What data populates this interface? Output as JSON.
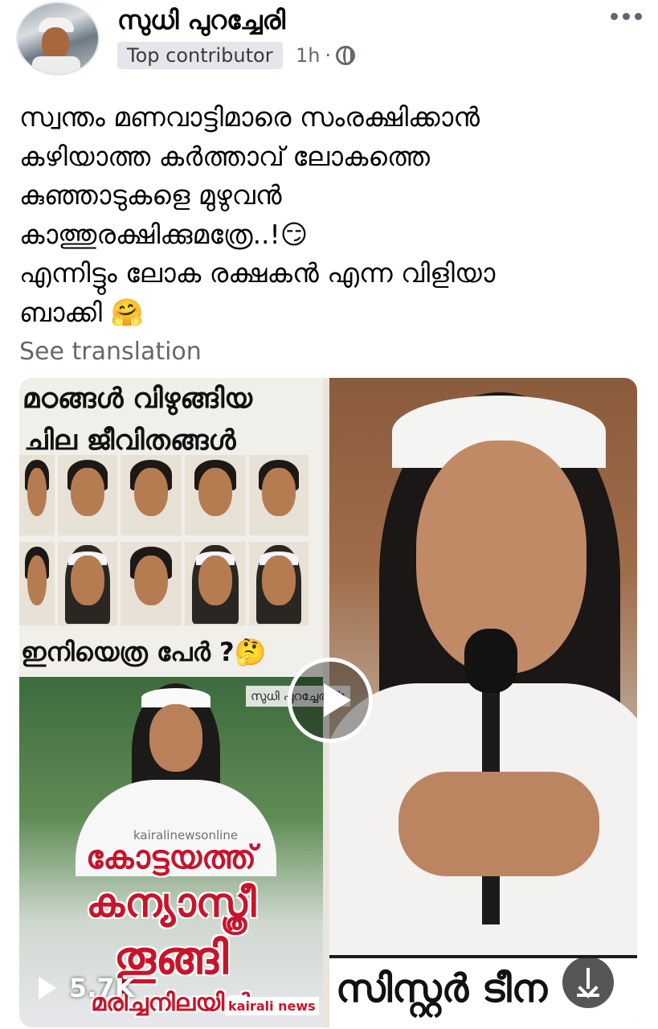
{
  "post": {
    "author_name": "സുധി പുറച്ചേരി",
    "badge": "Top contributor",
    "time": "1h",
    "separator": "·",
    "privacy_icon": "globe-icon",
    "more_icon": "more-horizontal-icon",
    "text_lines": [
      "സ്വന്തം മണവാട്ടിമാരെ സംരക്ഷിക്കാൻ",
      "കഴിയാത്ത  കർത്താവ് ലോകത്തെ",
      "കുഞ്ഞാടുകളെ മുഴുവൻ",
      "കാത്തുരക്ഷിക്കുമത്രേ..!😏",
      "എന്നിട്ടും ലോക രക്ഷകൻ എന്ന വിളിയാ",
      "ബാക്കി 🤗"
    ],
    "see_translation": "See translation"
  },
  "media": {
    "left_panel": {
      "title_line1": "മഠങ്ങൾ വിഴുങ്ങിയ",
      "title_line2": "ചില  ജീവിതങ്ങൾ",
      "question": "ഇനിയെത്ര പേർ ?🤔",
      "site_watermark": "kairalinewsonline",
      "headline_line1": "കോട്ടയത്ത്",
      "headline_line2": "കന്യാസ്ത്രീ",
      "headline_line3": "തൂങ്ങി",
      "headline_line4": "മരിച്ചനിലയിൽ",
      "logo": "kairali news"
    },
    "right_panel": {
      "caption": "സിസ്റ്റർ ടീന"
    },
    "video_watermark": "സുധി പുറച്ചേരി-fb",
    "play_icon": "play-icon",
    "view_count": "5.7K",
    "download_icon": "download-icon"
  },
  "colors": {
    "text_primary": "#050505",
    "text_secondary": "#65676b",
    "badge_bg": "#e4e6eb",
    "headline_red": "#c8142b"
  }
}
